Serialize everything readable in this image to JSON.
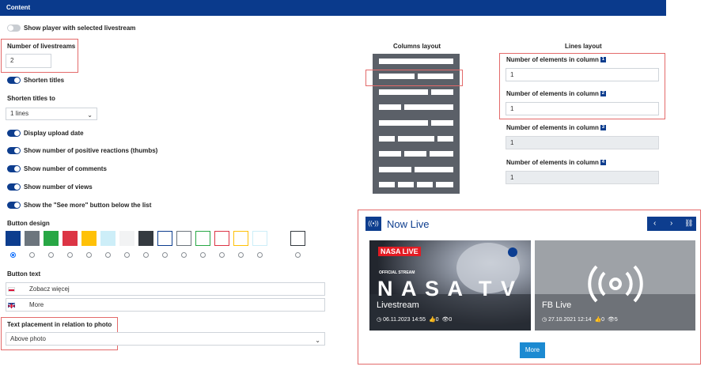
{
  "header": {
    "title": "Content"
  },
  "settings": {
    "show_player_label": "Show player with selected livestream",
    "num_livestreams_label": "Number of livestreams",
    "num_livestreams_value": "2",
    "shorten_titles_label": "Shorten titles",
    "shorten_titles_to_label": "Shorten titles to",
    "shorten_titles_to_value": "1 lines",
    "display_upload_date_label": "Display upload date",
    "show_positive_reactions_label": "Show number of positive reactions (thumbs)",
    "show_comments_label": "Show number of comments",
    "show_views_label": "Show number of views",
    "show_see_more_label": "Show the \"See more\" button below the list",
    "button_design_label": "Button design",
    "button_text_label": "Button text",
    "button_text_pl": "Zobacz więcej",
    "button_text_en": "More",
    "text_placement_label": "Text placement in relation to photo",
    "text_placement_value": "Above photo"
  },
  "layout": {
    "columns_layout_label": "Columns layout",
    "lines_layout_label": "Lines layout",
    "column_label": "Number of elements in column",
    "columns": [
      {
        "index": "1",
        "value": "1"
      },
      {
        "index": "2",
        "value": "1"
      },
      {
        "index": "3",
        "value": "1"
      },
      {
        "index": "4",
        "value": "1"
      }
    ]
  },
  "swatch_colors": [
    "#0d3d8e",
    "#6c757d",
    "#28a745",
    "#dc3545",
    "#ffc107",
    "#cdeef8",
    "#f2f3f4",
    "#343a40",
    "#ffffff",
    "#ffffff",
    "#ffffff",
    "#ffffff",
    "#ffffff",
    "#ffffff",
    "#ffffff"
  ],
  "swatch_borders": [
    "",
    "",
    "",
    "",
    "",
    "",
    "",
    "",
    "#0d3d8e",
    "#6c757d",
    "#28a745",
    "#dc3545",
    "#ffc107",
    "#cdeef8",
    "#343a40"
  ],
  "live_widget": {
    "title": "Now Live",
    "cards": [
      {
        "badge": "NASA LIVE",
        "stream": "OFFICIAL STREAM",
        "big": "N A S A  T V",
        "title": "Livestream",
        "date": "06.11.2023 14:55",
        "thumbs": "0",
        "views": "0"
      },
      {
        "title": "FB Live",
        "date": "27.10.2021 12:14",
        "thumbs": "0",
        "views": "5"
      }
    ],
    "more_label": "More"
  }
}
